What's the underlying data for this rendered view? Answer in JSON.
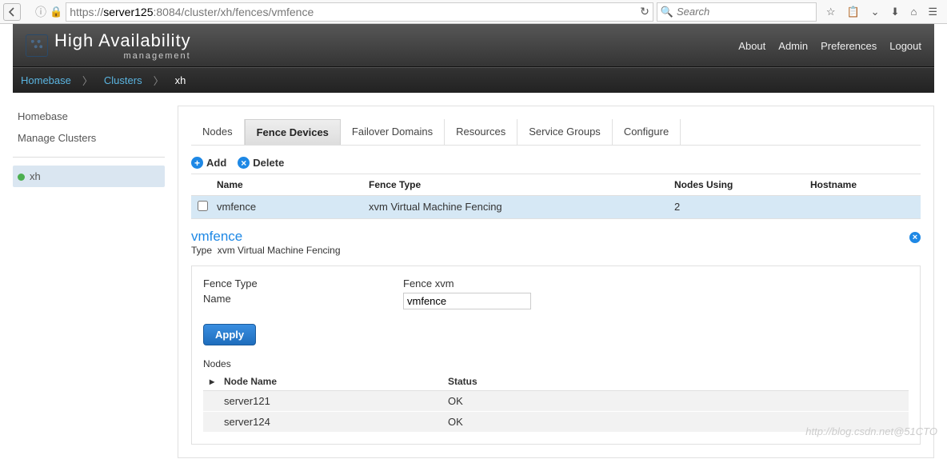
{
  "browser": {
    "url_pre": "https://",
    "url_host": "server125",
    "url_rest": ":8084/cluster/xh/fences/vmfence",
    "search_placeholder": "Search"
  },
  "topnav": {
    "about": "About",
    "admin": "Admin",
    "prefs": "Preferences",
    "logout": "Logout"
  },
  "logo": {
    "title": "High Availability",
    "sub": "management"
  },
  "breadcrumb": {
    "home": "Homebase",
    "clusters": "Clusters",
    "current": "xh"
  },
  "sidebar": {
    "home": "Homebase",
    "manage": "Manage Clusters",
    "cluster": "xh"
  },
  "tabs": {
    "nodes": "Nodes",
    "fence": "Fence Devices",
    "failover": "Failover Domains",
    "resources": "Resources",
    "service": "Service Groups",
    "configure": "Configure"
  },
  "actions": {
    "add": "Add",
    "delete": "Delete"
  },
  "grid": {
    "h_name": "Name",
    "h_type": "Fence Type",
    "h_nodes": "Nodes Using",
    "h_host": "Hostname",
    "rows": [
      {
        "name": "vmfence",
        "type": "xvm Virtual Machine Fencing",
        "nodes": "2",
        "host": ""
      }
    ]
  },
  "detail": {
    "title": "vmfence",
    "sub_label": "Type",
    "sub_value": "xvm Virtual Machine Fencing",
    "fence_type_label": "Fence Type",
    "fence_type_value": "Fence xvm",
    "name_label": "Name",
    "name_value": "vmfence",
    "apply": "Apply"
  },
  "nodes_section": {
    "title": "Nodes",
    "h_name": "Node Name",
    "h_status": "Status",
    "rows": [
      {
        "name": "server121",
        "status": "OK"
      },
      {
        "name": "server124",
        "status": "OK"
      }
    ]
  },
  "watermark": "http://blog.csdn.net@51CTO"
}
